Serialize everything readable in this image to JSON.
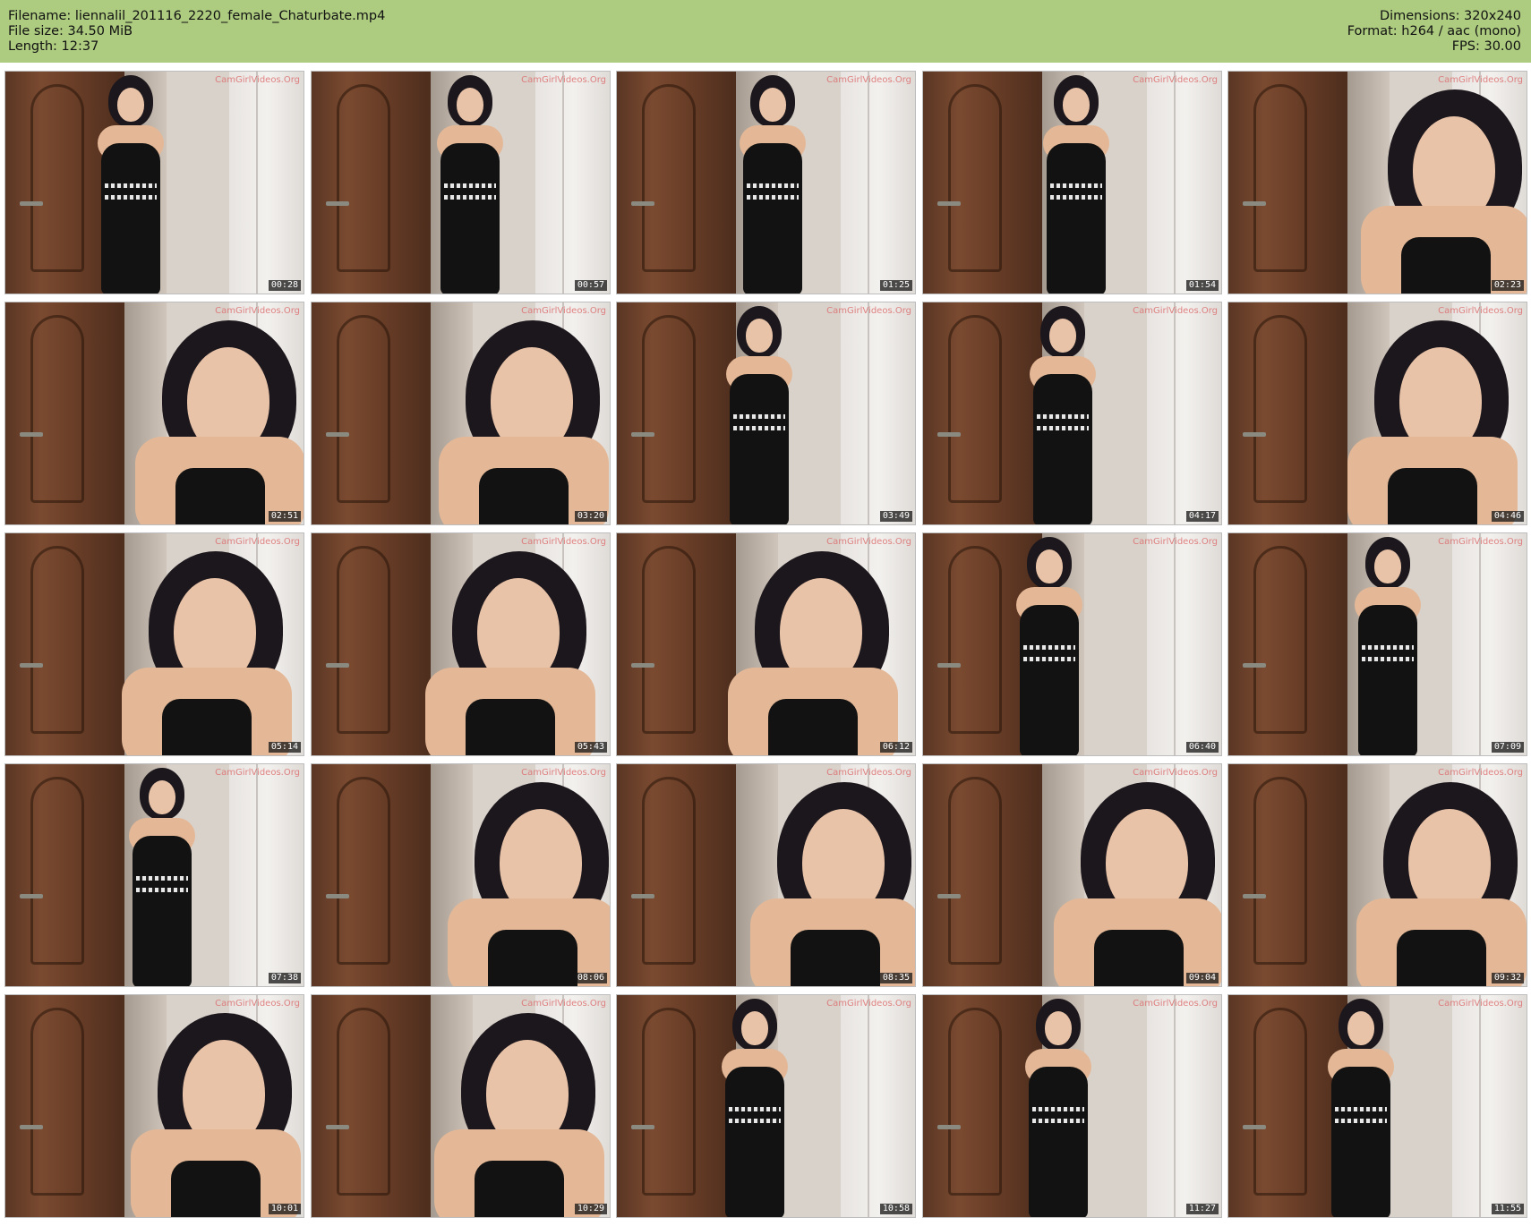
{
  "header": {
    "filename": "Filename: liennalil_201116_2220_female_Chaturbate.mp4",
    "filesize": "File size: 34.50 MiB",
    "length": "Length: 12:37",
    "dimensions": "Dimensions: 320x240",
    "format": "Format: h264 / aac (mono)",
    "fps": "FPS: 30.00",
    "background_color": "#adcc80"
  },
  "watermark": "CamGirlVideos.Org",
  "frames": [
    {
      "time": "00:28",
      "shot": "full"
    },
    {
      "time": "00:57",
      "shot": "full"
    },
    {
      "time": "01:25",
      "shot": "full"
    },
    {
      "time": "01:54",
      "shot": "full"
    },
    {
      "time": "02:23",
      "shot": "close"
    },
    {
      "time": "02:51",
      "shot": "close"
    },
    {
      "time": "03:20",
      "shot": "close"
    },
    {
      "time": "03:49",
      "shot": "full"
    },
    {
      "time": "04:17",
      "shot": "full"
    },
    {
      "time": "04:46",
      "shot": "close"
    },
    {
      "time": "05:14",
      "shot": "close"
    },
    {
      "time": "05:43",
      "shot": "close"
    },
    {
      "time": "06:12",
      "shot": "close"
    },
    {
      "time": "06:40",
      "shot": "full"
    },
    {
      "time": "07:09",
      "shot": "full"
    },
    {
      "time": "07:38",
      "shot": "full"
    },
    {
      "time": "08:06",
      "shot": "close"
    },
    {
      "time": "08:35",
      "shot": "close"
    },
    {
      "time": "09:04",
      "shot": "close"
    },
    {
      "time": "09:32",
      "shot": "close"
    },
    {
      "time": "10:01",
      "shot": "close"
    },
    {
      "time": "10:29",
      "shot": "close"
    },
    {
      "time": "10:58",
      "shot": "full"
    },
    {
      "time": "11:27",
      "shot": "full"
    },
    {
      "time": "11:55",
      "shot": "full"
    }
  ]
}
